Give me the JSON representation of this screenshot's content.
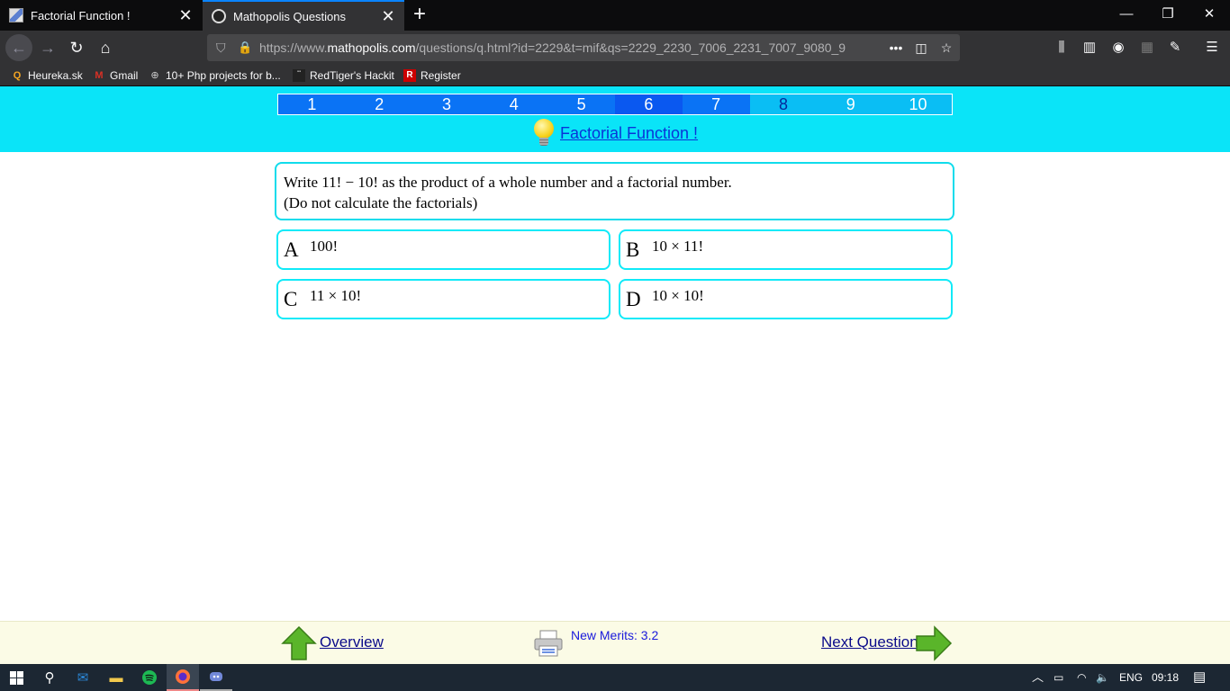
{
  "tabs": [
    {
      "title": "Factorial Function !"
    },
    {
      "title": "Mathopolis Questions"
    }
  ],
  "window_controls": {
    "minimize": "—",
    "restore": "❐",
    "close": "✕"
  },
  "nav": {
    "back": "←",
    "forward": "→",
    "reload": "↻",
    "home": "⌂"
  },
  "urlbar": {
    "url_prefix": "https://www.",
    "url_host": "mathopolis.com",
    "url_rest": "/questions/q.html?id=2229&t=mif&qs=2229_2230_7006_2231_7007_9080_9",
    "more": "•••"
  },
  "bookmarks": [
    {
      "label": "Heureka.sk",
      "icon": "search-icon",
      "color": "#f5a623"
    },
    {
      "label": "Gmail",
      "icon": "gmail-icon",
      "color": "#d93025"
    },
    {
      "label": "10+ Php projects for b...",
      "icon": "globe-icon",
      "color": "#cccccc"
    },
    {
      "label": "RedTiger's Hackit",
      "icon": "hackit-icon",
      "color": "#888888"
    },
    {
      "label": "Register",
      "icon": "register-icon",
      "color": "#c00000"
    }
  ],
  "question_nav": [
    "1",
    "2",
    "3",
    "4",
    "5",
    "6",
    "7",
    "8",
    "9",
    "10"
  ],
  "current_question": 6,
  "topic_link": "Factorial Function !",
  "question": {
    "line1": "Write 11! − 10! as the product of a whole number and a factorial number.",
    "line2": "(Do not calculate the factorials)"
  },
  "answers": [
    {
      "letter": "A",
      "value": "100!"
    },
    {
      "letter": "B",
      "value": "10 × 11!"
    },
    {
      "letter": "C",
      "value": "11 × 10!"
    },
    {
      "letter": "D",
      "value": "10 × 10!"
    }
  ],
  "footer": {
    "overview": "Overview",
    "merits": "New Merits: 3.2",
    "next": "Next Question"
  },
  "taskbar": {
    "lang": "ENG",
    "time": "09:18"
  },
  "colors": {
    "header_bg": "#0ae4f8",
    "answer_border": "#10eaf8",
    "link": "#0a34d8"
  }
}
